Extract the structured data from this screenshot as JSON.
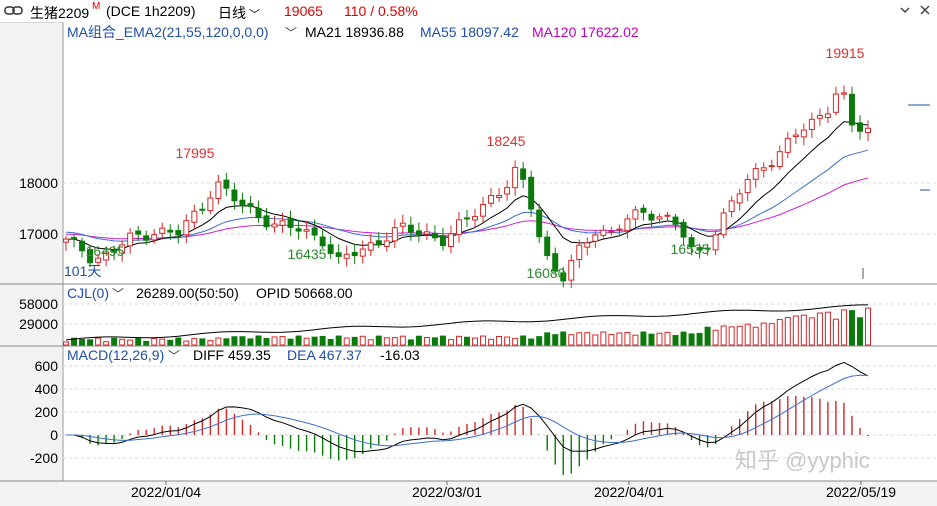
{
  "titlebar": {
    "symbol": "生猪2209",
    "main_badge": "M",
    "exchange_info": "(DCE 1h2209)",
    "period": "日线",
    "last_price": "19065",
    "change": "110 / 0.58%"
  },
  "main_panel": {
    "indicator": "MA组合_EMA2(21,55,120,0,0,0)",
    "ma21": "MA21 18936.88",
    "ma55": "MA55 18097.42",
    "ma120": "MA120 17622.02",
    "days_label": "101天",
    "y_ticks": [
      "18000",
      "17000"
    ],
    "annotations": [
      {
        "text": "17995",
        "color": "#e03030"
      },
      {
        "text": "18245",
        "color": "#e03030"
      },
      {
        "text": "19915",
        "color": "#e03030"
      },
      {
        "text": "16495",
        "color": "#2a8a2a"
      },
      {
        "text": "16435",
        "color": "#2a8a2a"
      },
      {
        "text": "16080",
        "color": "#2a8a2a"
      },
      {
        "text": "16535",
        "color": "#2a8a2a"
      }
    ]
  },
  "volume_panel": {
    "indicator": "CJL(0)",
    "value": "26289.00(50:50)",
    "opid": "OPID 50668.00",
    "y_ticks": [
      "58000",
      "29000"
    ]
  },
  "macd_panel": {
    "indicator": "MACD(12,26,9)",
    "diff": "DIFF 459.35",
    "dea": "DEA 467.37",
    "macd": "-16.03",
    "y_ticks": [
      "600",
      "400",
      "200",
      "0",
      "-200"
    ]
  },
  "x_axis": {
    "labels": [
      "2022/01/04",
      "2022/03/01",
      "2022/04/01",
      "2022/05/19"
    ]
  },
  "watermark": "知乎 @yyphic",
  "colors": {
    "up": "#d62828",
    "down": "#0b7a0b",
    "ma21": "#000000",
    "ma55": "#3a6fd0",
    "ma120": "#d020d0",
    "label_blue": "#1f4fa8",
    "label_magenta": "#c000c0",
    "price_red": "#e00000"
  },
  "chart_data": {
    "type": "candlestick",
    "ohlc_points": 101,
    "price_extremes": {
      "high": 19915,
      "lows": [
        16495,
        16435,
        16080,
        16535
      ],
      "highs": [
        17995,
        18245,
        19915
      ]
    },
    "ma_last": {
      "MA21": 18936.88,
      "MA55": 18097.42,
      "MA120": 17622.02
    },
    "volume_last": 26289.0,
    "open_interest": 50668.0,
    "macd_last": {
      "DIFF": 459.35,
      "DEA": 467.37,
      "MACD": -16.03
    },
    "x_labels": [
      "2022/01/04",
      "2022/03/01",
      "2022/04/01",
      "2022/05/19"
    ]
  }
}
